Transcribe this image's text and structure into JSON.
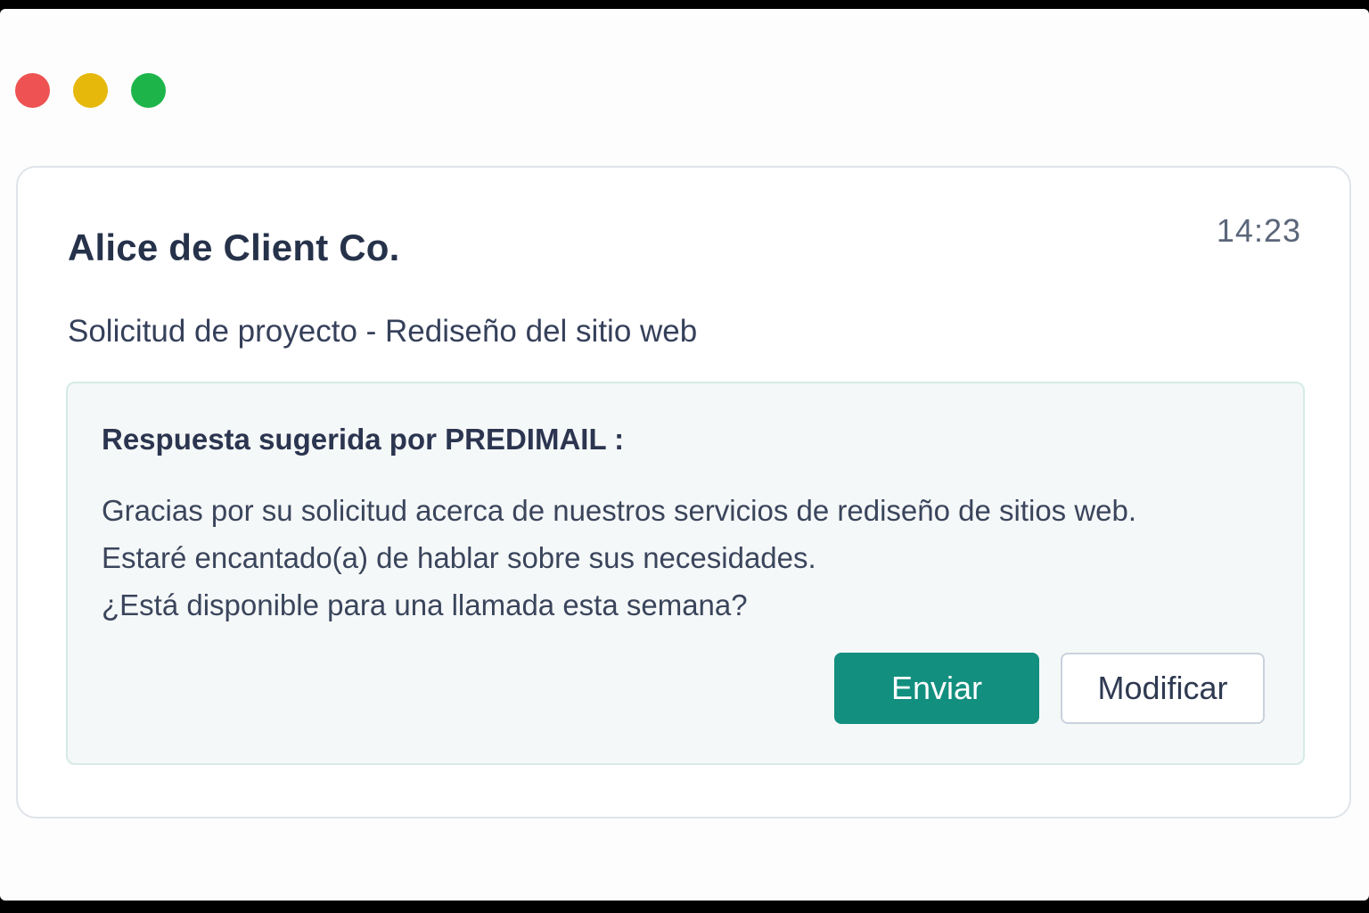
{
  "window": {
    "controls": [
      "close",
      "minimize",
      "maximize"
    ],
    "colors": {
      "close": "#ee5252",
      "minimize": "#e6b80c",
      "maximize": "#1db54a"
    }
  },
  "email": {
    "sender": "Alice de Client Co.",
    "time": "14:23",
    "subject": "Solicitud de proyecto - Rediseño del sitio web"
  },
  "suggestion": {
    "title": "Respuesta sugerida por PREDIMAIL :",
    "lines": [
      "Gracias por su solicitud acerca de nuestros servicios de rediseño de sitios web.",
      "Estaré encantado(a) de hablar sobre sus necesidades.",
      "¿Está disponible para una llamada esta semana?"
    ],
    "send_label": "Enviar",
    "modify_label": "Modificar"
  },
  "colors": {
    "accent": "#138f7f",
    "text_primary": "#26324a"
  }
}
